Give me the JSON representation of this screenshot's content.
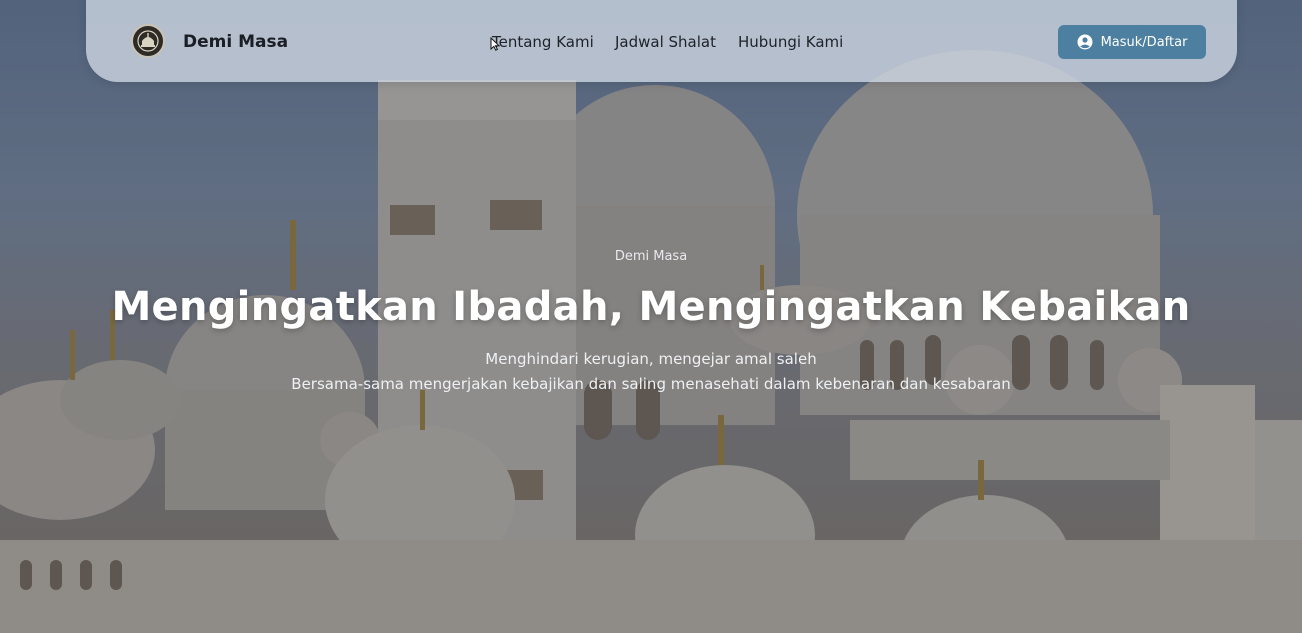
{
  "navbar": {
    "brand": "Demi Masa",
    "logo_icon": "mosque-emblem-icon",
    "links": [
      {
        "label": "Tentang Kami"
      },
      {
        "label": "Jadwal Shalat"
      },
      {
        "label": "Hubungi Kami"
      }
    ],
    "login_label": "Masuk/Daftar",
    "login_icon": "user-circle-icon"
  },
  "hero": {
    "eyebrow": "Demi Masa",
    "headline": "Mengingatkan Ibadah, Mengingatkan Kebaikan",
    "subtitle_1": "Menghindari kerugian, mengejar amal saleh",
    "subtitle_2": "Bersama-sama mengerjakan kebajikan dan saling menasehati dalam kebenaran dan kesabaran",
    "background": "mosque-domes-photo"
  },
  "colors": {
    "accent": "#4d7fa0",
    "navbar_bg": "#cdd6e2",
    "headline": "#ffffff"
  }
}
